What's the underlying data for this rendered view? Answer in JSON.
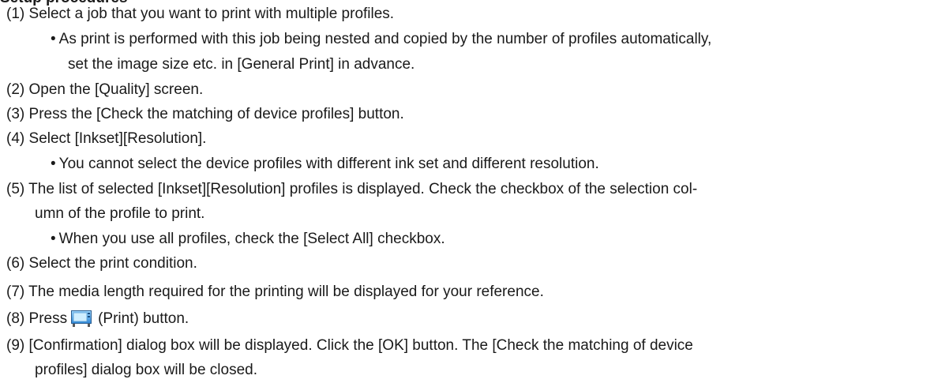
{
  "page": {
    "heading": "Setup procedures",
    "steps": [
      {
        "num": "(1)",
        "text": "Select a job that you want to print with multiple profiles."
      },
      {
        "bullet": "•",
        "text": "As print is performed with this job being nested and copied by the number of profiles automatically,"
      },
      {
        "text": "set the image size etc. in [General Print] in advance."
      },
      {
        "num": "(2)",
        "text": "Open the [Quality] screen."
      },
      {
        "num": "(3)",
        "text": "Press the [Check the matching of device profiles] button."
      },
      {
        "num": "(4)",
        "text": "Select [Inkset][Resolution]."
      },
      {
        "bullet": "•",
        "text": "You cannot select the device profiles with different ink set and different resolution."
      },
      {
        "num": "(5)",
        "text": "The list of selected [Inkset][Resolution] profiles is displayed. Check the checkbox of the selection col-"
      },
      {
        "text": "umn of the profile to print."
      },
      {
        "bullet": "•",
        "text": "When you use all profiles, check the [Select All] checkbox."
      },
      {
        "num": "(6)",
        "text": "Select the print condition."
      },
      {
        "num": "(7)",
        "text": "The media length required for the printing will be displayed for your reference."
      },
      {
        "num": "(8)",
        "text_before": "Press",
        "icon": "print-icon",
        "text_after": "(Print) button."
      },
      {
        "num": "(9)",
        "text": "[Confirmation] dialog box will be displayed. Click the [OK] button. The [Check the matching of device"
      },
      {
        "text": "profiles] dialog box will be closed."
      }
    ]
  }
}
